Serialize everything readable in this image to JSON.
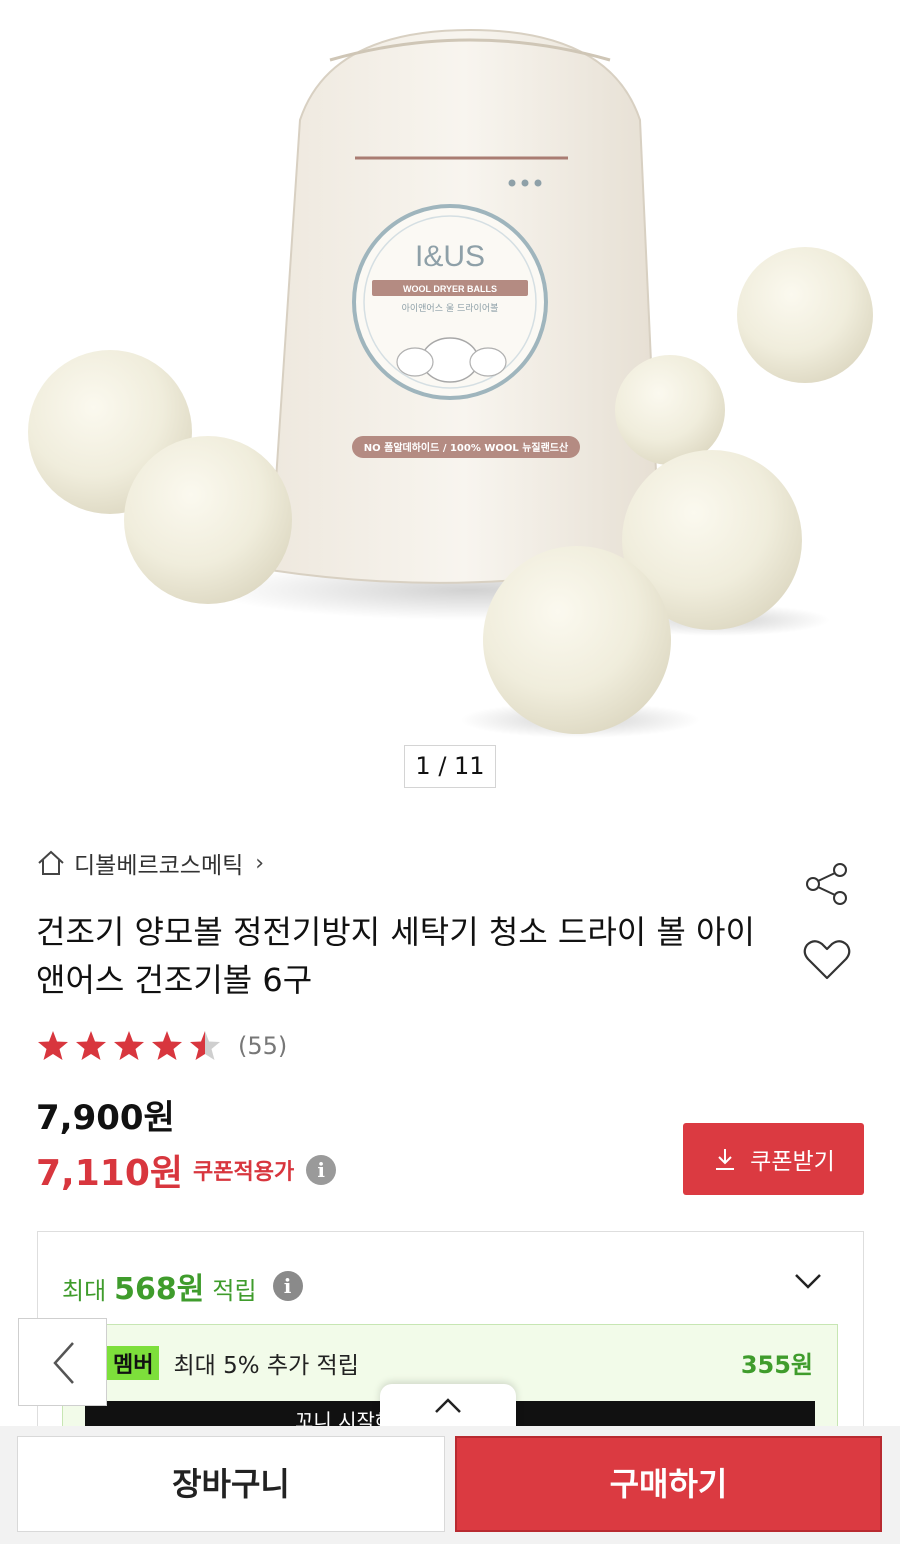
{
  "hero": {
    "bag_brand": "I&US",
    "bag_ribbon": "WOOL DRYER BALLS",
    "bag_ribbon_sub": "아이앤어스 울 드라이어볼",
    "bag_bottom_ribbon": "NO 폼알데하이드 / 100% WOOL 뉴질랜드산",
    "counter": "1 / 11"
  },
  "store": {
    "name": "디볼베르코스메틱",
    "icon": "home-icon"
  },
  "product": {
    "title": "건조기 양모볼 정전기방지 세탁기 청소 드라이 볼 아이앤어스 건조기볼 6구",
    "rating": 4.5,
    "review_count": "(55)"
  },
  "price": {
    "original": "7,900원",
    "coupon_price": "7,110원",
    "coupon_label": "쿠폰적용가"
  },
  "coupon_button": {
    "label": "쿠폰받기",
    "icon": "download-icon"
  },
  "points": {
    "prefix": "최대",
    "amount": "568원",
    "suffix": "적립",
    "member_badge": "멤버",
    "member_text": "최대 5% 추가 적립",
    "member_amount": "355원",
    "member_bar_text": "꼬니 시작해 받기 >"
  },
  "bottom": {
    "cart_label": "장바구니",
    "buy_label": "구매하기"
  },
  "colors": {
    "accent_red": "#db3a41",
    "points_green": "#3f9c2c",
    "star_red": "#d8363e"
  }
}
